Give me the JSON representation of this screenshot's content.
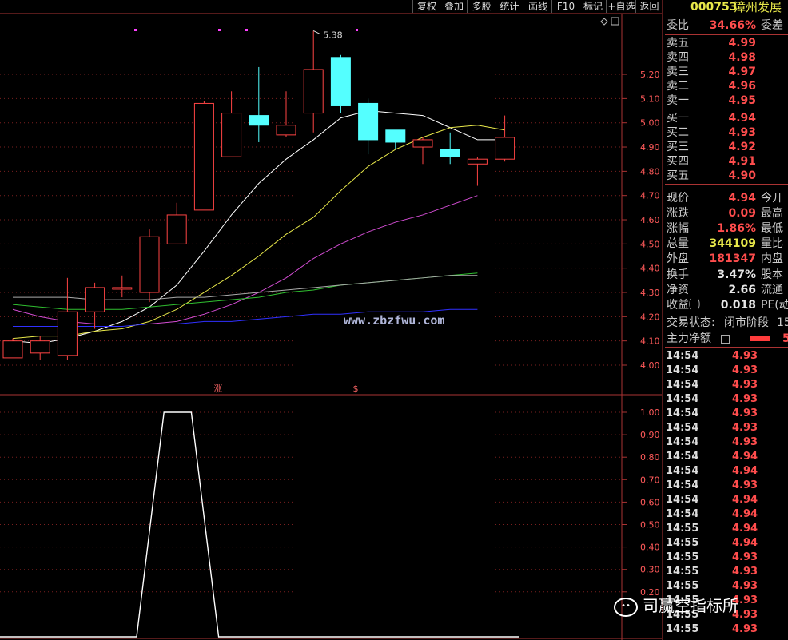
{
  "toolbar": {
    "buttons": [
      "复权",
      "叠加",
      "多股",
      "统计",
      "画线",
      "F10",
      "标记",
      "+自选",
      "返回"
    ]
  },
  "stock": {
    "code": "000753",
    "name": "漳州发展"
  },
  "quote": {
    "weibi_label": "委比",
    "weibi": "34.66%",
    "weicha_label": "委差",
    "asks": [
      {
        "label": "卖五",
        "price": "4.99"
      },
      {
        "label": "卖四",
        "price": "4.98"
      },
      {
        "label": "卖三",
        "price": "4.97"
      },
      {
        "label": "卖二",
        "price": "4.96"
      },
      {
        "label": "卖一",
        "price": "4.95"
      }
    ],
    "bids": [
      {
        "label": "买一",
        "price": "4.94"
      },
      {
        "label": "买二",
        "price": "4.93"
      },
      {
        "label": "买三",
        "price": "4.92"
      },
      {
        "label": "买四",
        "price": "4.91"
      },
      {
        "label": "买五",
        "price": "4.90"
      }
    ],
    "stats": [
      {
        "label": "现价",
        "value": "4.94",
        "color": "red",
        "right": "今开"
      },
      {
        "label": "涨跌",
        "value": "0.09",
        "color": "red",
        "right": "最高"
      },
      {
        "label": "涨幅",
        "value": "1.86%",
        "color": "red",
        "right": "最低"
      },
      {
        "label": "总量",
        "value": "344109",
        "color": "yel",
        "right": "量比"
      },
      {
        "label": "外盘",
        "value": "181347",
        "color": "red",
        "right": "内盘"
      }
    ],
    "stats2": [
      {
        "label": "换手",
        "value": "3.47%",
        "right": "股本"
      },
      {
        "label": "净资",
        "value": "2.66",
        "right": "流通"
      },
      {
        "label": "收益㈠",
        "value": "0.018",
        "right": "PE(动"
      }
    ],
    "trade_status_label": "交易状态:",
    "trade_status": "闭市阶段",
    "trade_status_extra": "15",
    "main_net_label": "主力净额",
    "main_net_extra": "5"
  },
  "ticks": [
    {
      "time": "14:54",
      "price": "4.93"
    },
    {
      "time": "14:54",
      "price": "4.93"
    },
    {
      "time": "14:54",
      "price": "4.93"
    },
    {
      "time": "14:54",
      "price": "4.93"
    },
    {
      "time": "14:54",
      "price": "4.93"
    },
    {
      "time": "14:54",
      "price": "4.93"
    },
    {
      "time": "14:54",
      "price": "4.93"
    },
    {
      "time": "14:54",
      "price": "4.94"
    },
    {
      "time": "14:54",
      "price": "4.94"
    },
    {
      "time": "14:54",
      "price": "4.93"
    },
    {
      "time": "14:54",
      "price": "4.94"
    },
    {
      "time": "14:54",
      "price": "4.94"
    },
    {
      "time": "14:55",
      "price": "4.94"
    },
    {
      "time": "14:55",
      "price": "4.94"
    },
    {
      "time": "14:55",
      "price": "4.93"
    },
    {
      "time": "14:55",
      "price": "4.93"
    },
    {
      "time": "14:55",
      "price": "4.93"
    },
    {
      "time": "14:55",
      "price": "4.93"
    },
    {
      "time": "14:55",
      "price": "4.93"
    },
    {
      "time": "14:55",
      "price": "4.93"
    }
  ],
  "watermark": "www.zbzfwu.com",
  "logo_text": "司赢空指标所",
  "chart_data": [
    {
      "type": "candlestick",
      "annotation_high": "5.38",
      "markers": [
        "涨",
        "$"
      ],
      "ylim": [
        3.95,
        5.45
      ],
      "yticks": [
        "4.00",
        "4.10",
        "4.20",
        "4.30",
        "4.40",
        "4.50",
        "4.60",
        "4.70",
        "4.80",
        "4.90",
        "5.00",
        "5.10",
        "5.20"
      ],
      "candles": [
        {
          "o": 4.03,
          "c": 4.1,
          "h": 4.11,
          "l": 4.03
        },
        {
          "o": 4.05,
          "c": 4.1,
          "h": 4.12,
          "l": 4.02
        },
        {
          "o": 4.04,
          "c": 4.22,
          "h": 4.36,
          "l": 4.02
        },
        {
          "o": 4.22,
          "c": 4.32,
          "h": 4.34,
          "l": 4.15
        },
        {
          "o": 4.32,
          "c": 4.32,
          "h": 4.37,
          "l": 4.28
        },
        {
          "o": 4.3,
          "c": 4.53,
          "h": 4.56,
          "l": 4.26
        },
        {
          "o": 4.5,
          "c": 4.62,
          "h": 4.67,
          "l": 4.5
        },
        {
          "o": 4.64,
          "c": 5.08,
          "h": 5.09,
          "l": 4.64
        },
        {
          "o": 4.86,
          "c": 5.04,
          "h": 5.13,
          "l": 4.86
        },
        {
          "o": 5.03,
          "c": 4.99,
          "h": 5.23,
          "l": 4.92
        },
        {
          "o": 4.95,
          "c": 4.99,
          "h": 5.13,
          "l": 4.94
        },
        {
          "o": 5.04,
          "c": 5.22,
          "h": 5.38,
          "l": 4.96
        },
        {
          "o": 5.27,
          "c": 5.07,
          "h": 5.28,
          "l": 5.04
        },
        {
          "o": 5.08,
          "c": 4.93,
          "h": 5.1,
          "l": 4.87
        },
        {
          "o": 4.97,
          "c": 4.92,
          "h": 4.97,
          "l": 4.89
        },
        {
          "o": 4.9,
          "c": 4.93,
          "h": 4.94,
          "l": 4.83
        },
        {
          "o": 4.89,
          "c": 4.86,
          "h": 4.96,
          "l": 4.83
        },
        {
          "o": 4.83,
          "c": 4.85,
          "h": 4.86,
          "l": 4.74
        },
        {
          "o": 4.85,
          "c": 4.94,
          "h": 5.03,
          "l": 4.84
        }
      ],
      "ma_lines": [
        {
          "color": "#ffffff",
          "values": [
            4.1,
            4.09,
            4.11,
            4.14,
            4.18,
            4.24,
            4.33,
            4.47,
            4.62,
            4.75,
            4.85,
            4.93,
            5.02,
            5.05,
            5.04,
            5.03,
            4.98,
            4.93,
            4.93
          ]
        },
        {
          "color": "#e8e84a",
          "values": [
            4.11,
            4.12,
            4.12,
            4.14,
            4.15,
            4.18,
            4.23,
            4.3,
            4.37,
            4.45,
            4.54,
            4.61,
            4.72,
            4.82,
            4.89,
            4.94,
            4.98,
            4.99,
            4.97
          ]
        },
        {
          "color": "#d14cd1",
          "values": [
            4.23,
            4.2,
            4.18,
            4.17,
            4.17,
            4.17,
            4.18,
            4.21,
            4.25,
            4.3,
            4.36,
            4.44,
            4.5,
            4.55,
            4.59,
            4.62,
            4.66,
            4.7
          ]
        },
        {
          "color": "#30c030",
          "values": [
            4.25,
            4.24,
            4.23,
            4.23,
            4.23,
            4.24,
            4.25,
            4.26,
            4.27,
            4.28,
            4.3,
            4.31,
            4.33,
            4.34,
            4.35,
            4.36,
            4.37,
            4.38
          ]
        },
        {
          "color": "#aaaaaa",
          "values": [
            4.28,
            4.28,
            4.28,
            4.27,
            4.27,
            4.27,
            4.28,
            4.28,
            4.29,
            4.3,
            4.31,
            4.32,
            4.33,
            4.34,
            4.35,
            4.36,
            4.37,
            4.37
          ]
        },
        {
          "color": "#3030ff",
          "values": [
            4.16,
            4.16,
            4.16,
            4.16,
            4.16,
            4.17,
            4.17,
            4.18,
            4.18,
            4.19,
            4.2,
            4.21,
            4.21,
            4.22,
            4.22,
            4.22,
            4.23,
            4.23
          ]
        }
      ]
    },
    {
      "type": "line",
      "ylim": [
        0,
        1.06
      ],
      "yticks": [
        "1.00",
        "0.90",
        "0.80",
        "0.70",
        "0.60",
        "0.50",
        "0.40",
        "0.30",
        "0.20"
      ],
      "values": [
        0,
        0,
        0,
        0,
        0,
        0,
        1,
        1,
        0,
        0,
        0,
        0,
        0,
        0,
        0,
        0,
        0,
        0,
        0,
        0
      ]
    }
  ]
}
